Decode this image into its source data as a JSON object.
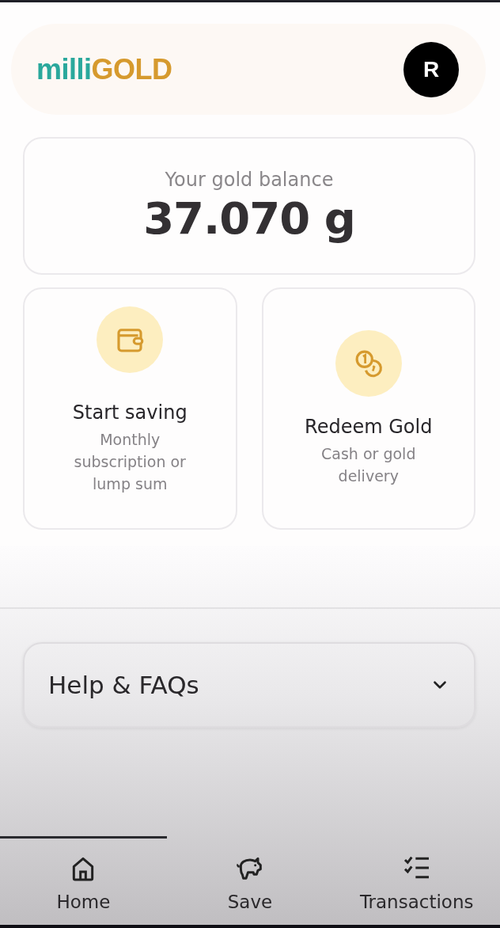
{
  "header": {
    "logo": [
      {
        "text": "milli",
        "color": "#2aa89c"
      },
      {
        "text": "GOLD",
        "color": "#d69a2e"
      }
    ],
    "avatar": "R"
  },
  "balance": {
    "label": "Your gold balance",
    "value": "37.070 g"
  },
  "actions": [
    {
      "kind": "wallet",
      "title": "Start saving",
      "subtitle": "Monthly subscription or lump sum"
    },
    {
      "kind": "coins",
      "title": "Redeem Gold",
      "subtitle": "Cash or gold delivery"
    }
  ],
  "help": {
    "title": "Help & FAQs",
    "expanded": false
  },
  "nav": [
    {
      "kind": "home",
      "label": "Home",
      "selected": true
    },
    {
      "kind": "piggy",
      "label": "Save",
      "selected": false
    },
    {
      "kind": "list",
      "label": "Transactions",
      "selected": false
    }
  ]
}
